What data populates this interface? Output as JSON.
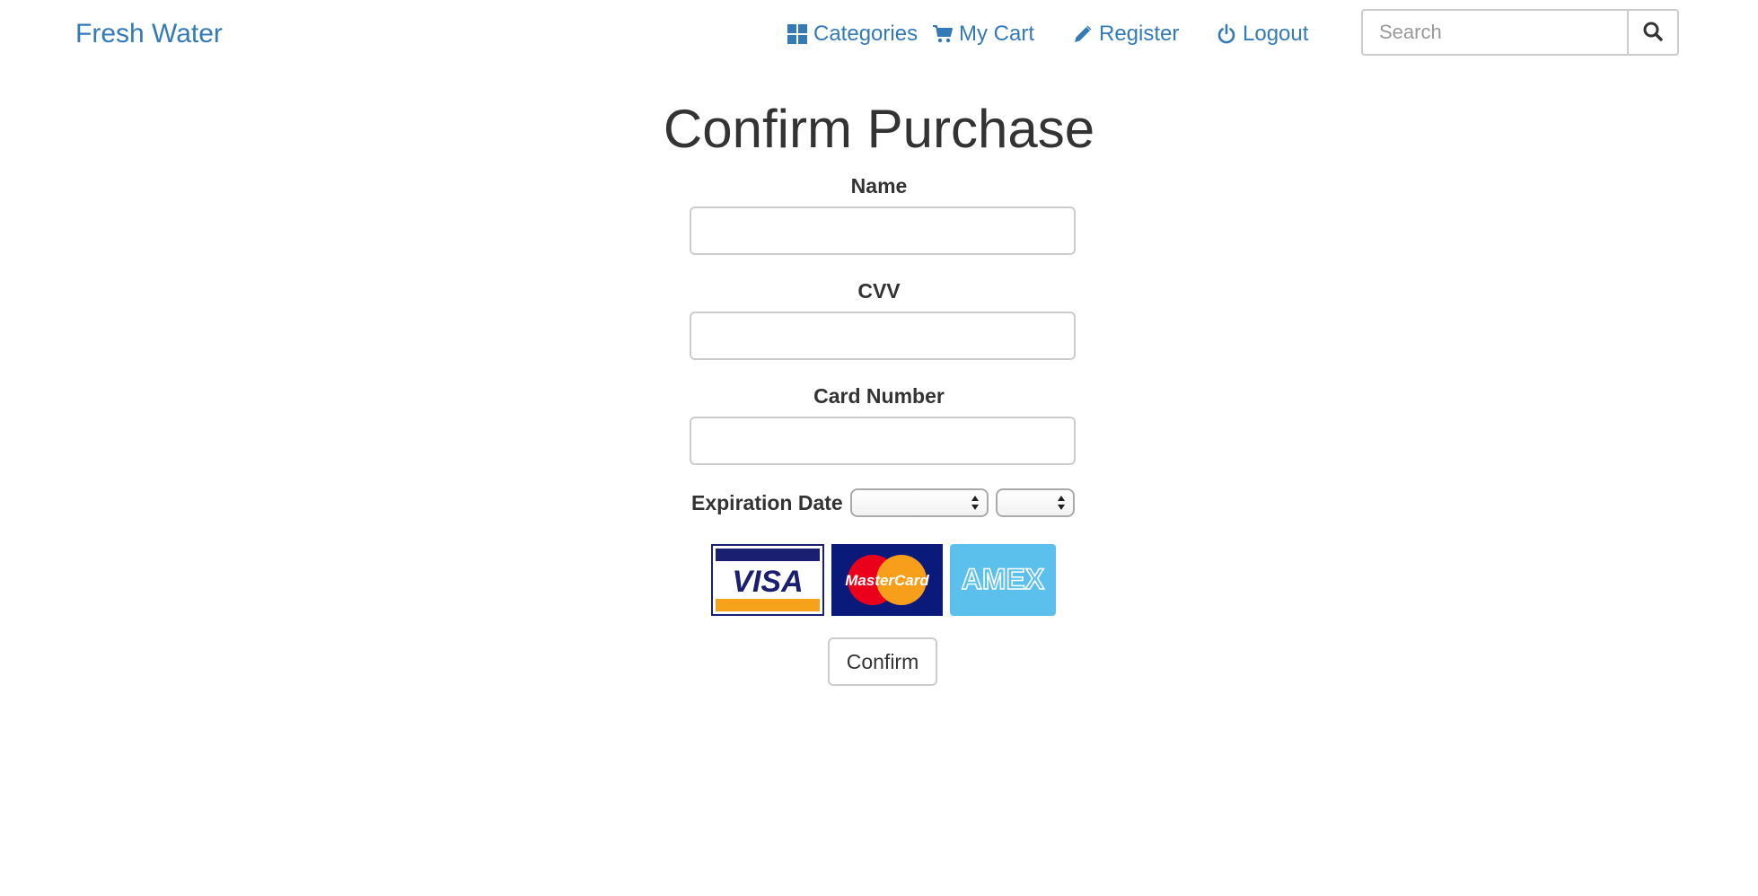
{
  "navbar": {
    "brand": "Fresh Water",
    "items": [
      {
        "label": "Categories",
        "icon": "grid-icon"
      },
      {
        "label": "My Cart",
        "icon": "cart-icon"
      },
      {
        "label": "Register",
        "icon": "pencil-icon"
      },
      {
        "label": "Logout",
        "icon": "power-icon"
      }
    ],
    "search": {
      "placeholder": "Search",
      "value": "",
      "icon": "search-icon"
    }
  },
  "form": {
    "title": "Confirm Purchase",
    "name_label": "Name",
    "name_value": "",
    "cvv_label": "CVV",
    "cvv_value": "",
    "card_number_label": "Card Number",
    "card_number_value": "",
    "expiration_label": "Expiration Date",
    "expiration_month": "",
    "expiration_year": "",
    "cards": [
      {
        "brand": "visa",
        "text": "VISA"
      },
      {
        "brand": "mastercard",
        "text": "MasterCard"
      },
      {
        "brand": "amex",
        "text": "AMEX"
      }
    ],
    "confirm_label": "Confirm"
  },
  "colors": {
    "link": "#337ab7",
    "text": "#333333",
    "border": "#cccccc",
    "visa_blue": "#1a1f71",
    "visa_gold": "#f7a21b",
    "mastercard_bg": "#0a1a7a",
    "mastercard_red": "#eb001b",
    "mastercard_yellow": "#f79e1b",
    "amex_blue": "#5bc0eb"
  }
}
